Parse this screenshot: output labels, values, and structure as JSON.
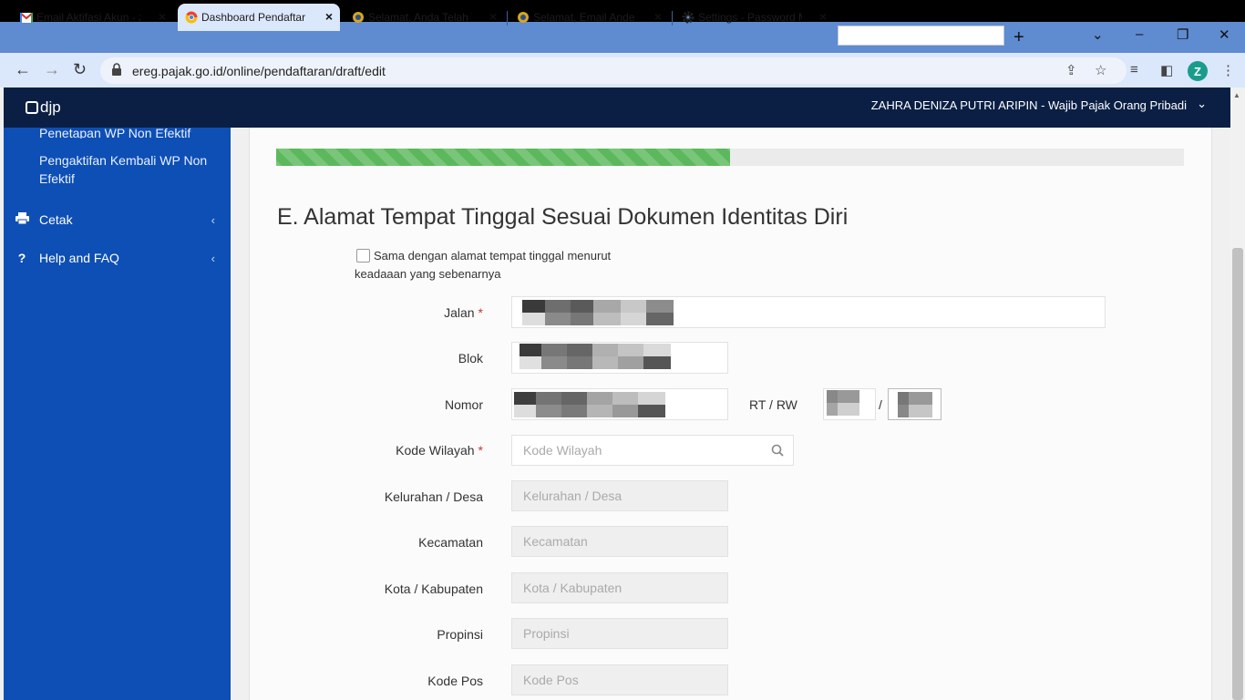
{
  "browser": {
    "tabs": [
      {
        "label": "Email Aktifasi Akun - z",
        "favicon": "gmail-icon"
      },
      {
        "label": "Dashboard Pendaftaran",
        "favicon": "chrome-icon",
        "active": true
      },
      {
        "label": "Selamat, Anda Telah T",
        "favicon": "djp-icon"
      },
      {
        "label": "Selamat, Email Ande T",
        "favicon": "djp-icon"
      },
      {
        "label": "Settings - Password M",
        "favicon": "gear-icon"
      }
    ],
    "url": "ereg.pajak.go.id/online/pendaftaran/draft/edit",
    "profile_initial": "Z"
  },
  "header": {
    "logo_text": "djp",
    "user": "ZAHRA DENIZA PUTRI ARIPIN - Wajib Pajak Orang Pribadi"
  },
  "sidebar": {
    "sub_items": [
      "Penetapan WP Non Efektif",
      "Pengaktifan Kembali WP Non Efektif"
    ],
    "items": [
      {
        "label": "Cetak",
        "icon": "printer-icon"
      },
      {
        "label": "Help and FAQ",
        "icon": "question-icon"
      }
    ]
  },
  "form": {
    "progress_percent": 50,
    "section_title": "E. Alamat Tempat Tinggal Sesuai Dokumen Identitas Diri",
    "same_address_checkbox": {
      "label_line1": "Sama dengan alamat tempat tinggal menurut",
      "label_line2": "keadaaan yang sebenarnya",
      "checked": false
    },
    "fields": {
      "jalan": {
        "label": "Jalan",
        "required": "*"
      },
      "blok": {
        "label": "Blok"
      },
      "nomor": {
        "label": "Nomor"
      },
      "rt_rw": {
        "label": "RT / RW",
        "separator": "/"
      },
      "kode_wilayah": {
        "label": "Kode Wilayah",
        "required": "*",
        "placeholder": "Kode Wilayah"
      },
      "kelurahan": {
        "label": "Kelurahan / Desa",
        "placeholder": "Kelurahan / Desa"
      },
      "kecamatan": {
        "label": "Kecamatan",
        "placeholder": "Kecamatan"
      },
      "kota": {
        "label": "Kota / Kabupaten",
        "placeholder": "Kota / Kabupaten"
      },
      "propinsi": {
        "label": "Propinsi",
        "placeholder": "Propinsi"
      },
      "kode_pos": {
        "label": "Kode Pos",
        "placeholder": "Kode Pos"
      }
    }
  },
  "colors": {
    "sidebar": "#0d4fb5",
    "header": "#0b1f45",
    "progress": "#5cb85c",
    "tabbar": "#5f8bd0"
  }
}
